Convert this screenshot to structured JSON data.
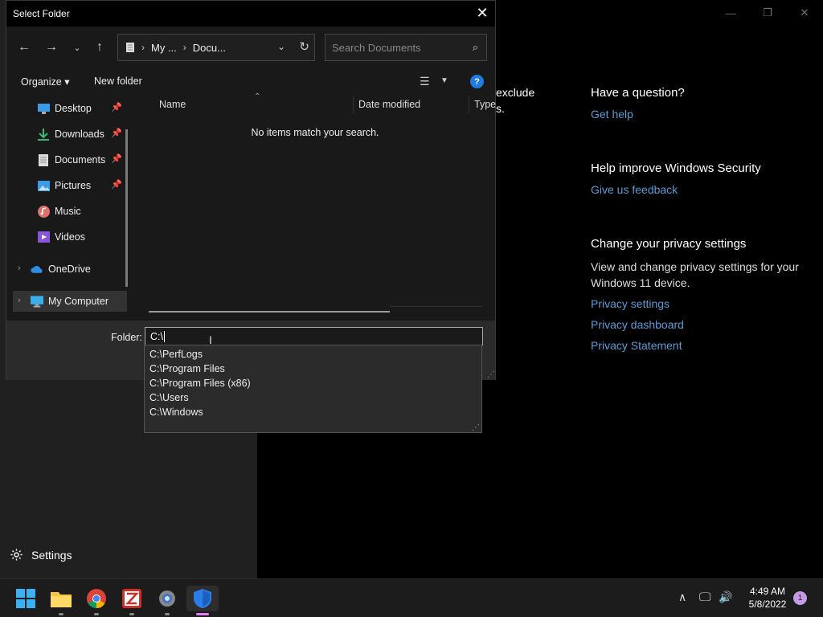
{
  "background_app": {
    "window_controls": {
      "minimize": "—",
      "maximize": "❐",
      "close": "✕"
    },
    "snippet_line1": "exclude",
    "snippet_line2": "s.",
    "question": {
      "heading": "Have a question?",
      "link": "Get help"
    },
    "improve": {
      "heading": "Help improve Windows Security",
      "link": "Give us feedback"
    },
    "privacy": {
      "heading": "Change your privacy settings",
      "text": "View and change privacy settings for your Windows 11 device.",
      "links": [
        "Privacy settings",
        "Privacy dashboard",
        "Privacy Statement"
      ]
    },
    "settings_label": "Settings"
  },
  "dialog": {
    "title": "Select Folder",
    "address": {
      "segment1": "My ...",
      "segment2": "Docu..."
    },
    "search_placeholder": "Search Documents",
    "commands": {
      "organize": "Organize ▾",
      "new_folder": "New folder",
      "help": "?"
    },
    "nav_items": [
      {
        "label": "Desktop",
        "icon": "desktop-icon",
        "pinned": true
      },
      {
        "label": "Downloads",
        "icon": "downloads-icon",
        "pinned": true
      },
      {
        "label": "Documents",
        "icon": "documents-icon",
        "pinned": true
      },
      {
        "label": "Pictures",
        "icon": "pictures-icon",
        "pinned": true
      },
      {
        "label": "Music",
        "icon": "music-icon",
        "pinned": false
      },
      {
        "label": "Videos",
        "icon": "videos-icon",
        "pinned": false
      },
      {
        "label": "OneDrive",
        "icon": "onedrive-icon",
        "pinned": false
      },
      {
        "label": "My Computer",
        "icon": "computer-icon",
        "pinned": false,
        "selected": true
      }
    ],
    "columns": [
      "Name",
      "Date modified",
      "Type"
    ],
    "empty_message": "No items match your search.",
    "folder_label": "Folder:",
    "folder_value": "C:\\",
    "autocomplete": [
      "C:\\PerfLogs",
      "C:\\Program Files",
      "C:\\Program Files (x86)",
      "C:\\Users",
      "C:\\Windows"
    ]
  },
  "taskbar": {
    "apps": [
      "start-icon",
      "file-explorer-icon",
      "chrome-icon",
      "app-z-icon",
      "settings-icon",
      "windows-security-icon"
    ],
    "time": "4:49 AM",
    "date": "5/8/2022",
    "notification_count": "1"
  },
  "colors": {
    "accent_link": "#5b9bd5",
    "help_blue": "#1e7be0",
    "notif_badge": "#c79ae8"
  }
}
